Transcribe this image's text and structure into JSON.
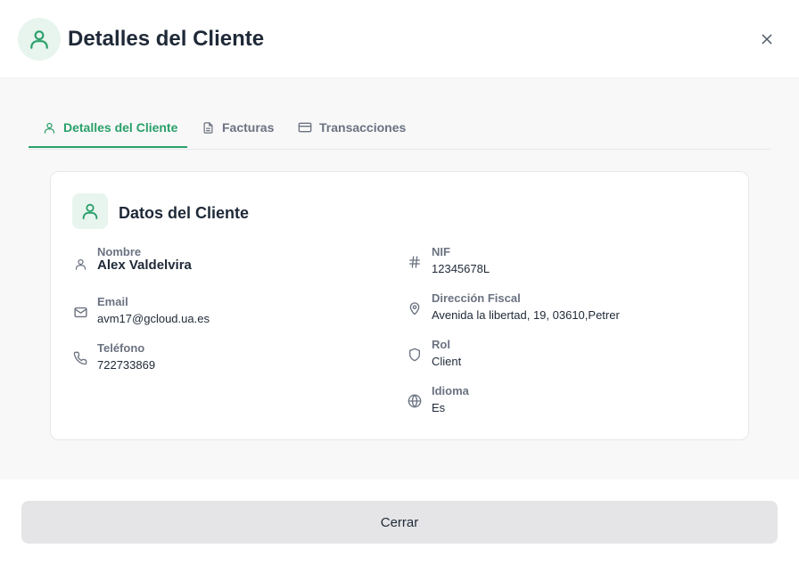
{
  "header": {
    "title": "Detalles del Cliente",
    "avatar_icon": "user-icon",
    "close_icon": "close-icon"
  },
  "tabs": [
    {
      "label": "Detalles del Cliente",
      "icon": "user-icon",
      "active": true
    },
    {
      "label": "Facturas",
      "icon": "document-icon",
      "active": false
    },
    {
      "label": "Transacciones",
      "icon": "credit-card-icon",
      "active": false
    }
  ],
  "card": {
    "title": "Datos del Cliente",
    "icon": "user-icon",
    "left_fields": [
      {
        "label": "Nombre",
        "value": "Alex Valdelvira",
        "icon": "user-icon"
      },
      {
        "label": "Email",
        "value": "avm17@gcloud.ua.es",
        "icon": "mail-icon"
      },
      {
        "label": "Teléfono",
        "value": "722733869",
        "icon": "phone-icon"
      }
    ],
    "right_fields": [
      {
        "label": "NIF",
        "value": "12345678L",
        "icon": "hash-icon"
      },
      {
        "label": "Dirección Fiscal",
        "value": "Avenida la libertad, 19, 03610,Petrer",
        "icon": "map-pin-icon"
      },
      {
        "label": "Rol",
        "value": "Client",
        "icon": "shield-icon"
      },
      {
        "label": "Idioma",
        "value": "Es",
        "icon": "globe-icon"
      }
    ]
  },
  "footer": {
    "close_label": "Cerrar"
  },
  "colors": {
    "accent": "#2aa06a",
    "accent_bg": "#e8f4ee",
    "muted": "#6b7280",
    "button_bg": "#e5e5e7"
  }
}
